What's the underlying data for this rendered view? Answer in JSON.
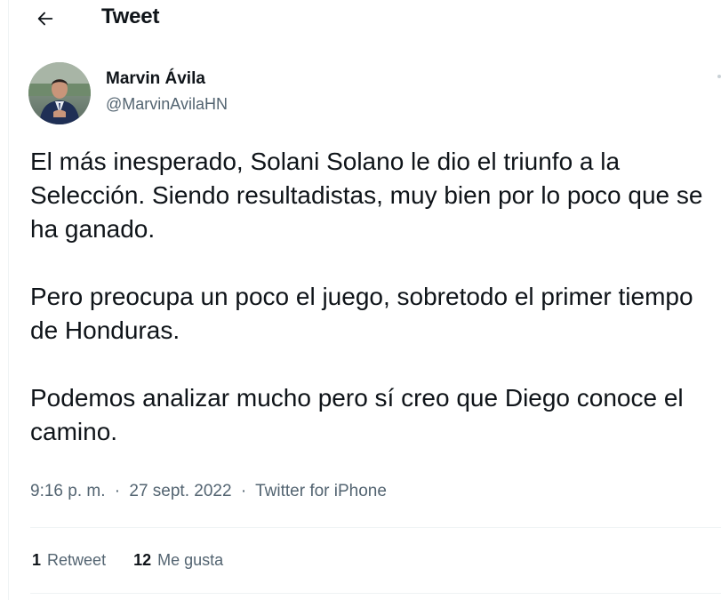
{
  "header": {
    "title": "Tweet",
    "back_icon": "arrow-left-icon"
  },
  "author": {
    "display_name": "Marvin Ávila",
    "handle": "@MarvinAvilaHN",
    "avatar_icon": "profile-photo"
  },
  "tweet": {
    "paragraphs": [
      "El más inesperado, Solani Solano le dio el triunfo a la Selección. Siendo resultadistas, muy bien por lo poco que se ha ganado.",
      "Pero preocupa un poco el juego, sobretodo el primer tiempo de Honduras.",
      "Podemos analizar mucho pero sí creo que Diego conoce el camino."
    ]
  },
  "meta": {
    "time": "9:16 p. m.",
    "separator": "·",
    "date": "27 sept. 2022",
    "source": "Twitter for iPhone"
  },
  "stats": {
    "retweets_count": "1",
    "retweets_label": "Retweet",
    "likes_count": "12",
    "likes_label": "Me gusta"
  },
  "colors": {
    "text_primary": "#0f1419",
    "text_secondary": "#536471",
    "divider": "#eff3f4",
    "background": "#ffffff"
  }
}
